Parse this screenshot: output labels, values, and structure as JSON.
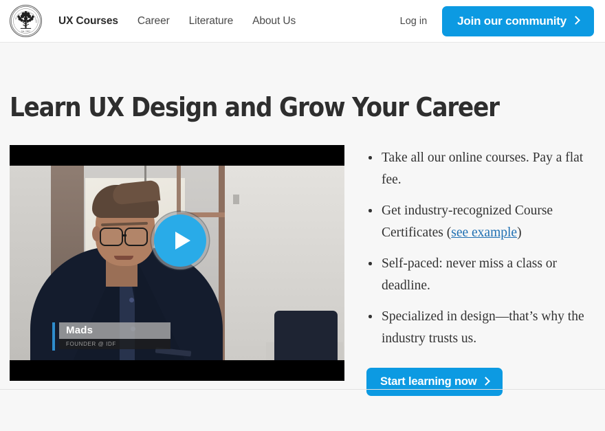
{
  "header": {
    "logo_icon": "tree-emblem-logo",
    "logo_alt": "Interaction Design Foundation tree emblem, Est. 2002",
    "nav": [
      {
        "label": "UX Courses",
        "active": true
      },
      {
        "label": "Career",
        "active": false
      },
      {
        "label": "Literature",
        "active": false
      },
      {
        "label": "About Us",
        "active": false
      }
    ],
    "login_label": "Log in",
    "join_label": "Join our community",
    "join_icon": "chevron-right-icon",
    "accent_color": "#0c9ae2"
  },
  "hero": {
    "title": "Learn UX Design and Grow Your Career",
    "video": {
      "play_icon": "play-triangle-icon",
      "speaker_name": "Mads",
      "speaker_role": "FOUNDER @ IDF",
      "accent_color": "#2e8ccc"
    },
    "bullets": [
      {
        "before": "Take all our online courses. Pay a flat fee.",
        "link": "",
        "after": ""
      },
      {
        "before": "Get industry-recognized Course Certificates (",
        "link": "see example",
        "after": ")"
      },
      {
        "before": "Self-paced: never miss a class or deadline.",
        "link": "",
        "after": ""
      },
      {
        "before": "Specialized in design—that’s why the industry trusts us.",
        "link": "",
        "after": ""
      }
    ],
    "link_color": "#1f6fb2",
    "cta_label": "Start learning now",
    "cta_icon": "chevron-right-icon"
  }
}
